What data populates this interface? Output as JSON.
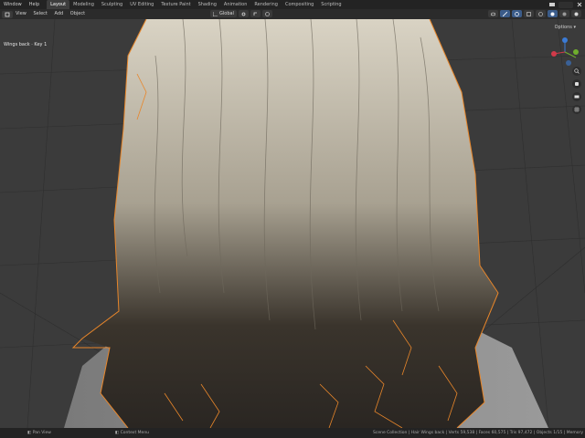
{
  "topbar": {
    "menu": [
      "Window",
      "Help"
    ],
    "tabs": [
      "Layout",
      "Modeling",
      "Sculpting",
      "UV Editing",
      "Texture Paint",
      "Shading",
      "Animation",
      "Rendering",
      "Compositing",
      "Scripting"
    ],
    "active_tab": "Layout",
    "scene_label": "Scene"
  },
  "viewheader": {
    "menu": [
      "View",
      "Select",
      "Add",
      "Object"
    ],
    "transform_label": "Global",
    "options_label": "Options"
  },
  "viewport": {
    "view_name": "Wings back · Key 1"
  },
  "statusbar": {
    "items": [
      "Pan View",
      "Context Menu"
    ],
    "stats": "Scene Collection | Hair Wings back | Verts 59,538 | Faces 60,575 | Tris 97,472 | Objects 1/15 | Memory"
  },
  "colors": {
    "accent": "#3b5c8a",
    "selection_outline": "#e8862a",
    "viewport_bg": "#3b3b3b",
    "header_bg": "#2b2b2b",
    "gizmo_x": "#d13a4a",
    "gizmo_y": "#6fae2d",
    "gizmo_z": "#3b7bd6"
  },
  "icons": [
    "blender-logo-icon",
    "object-mode-icon",
    "select-box-icon",
    "snap-icon",
    "proportional-edit-icon",
    "visibility-icon",
    "overlay-icon",
    "xray-icon",
    "solid-shading-icon",
    "material-shading-icon",
    "rendered-shading-icon",
    "zoom-icon",
    "hand-pan-icon",
    "camera-icon",
    "grid-icon"
  ]
}
